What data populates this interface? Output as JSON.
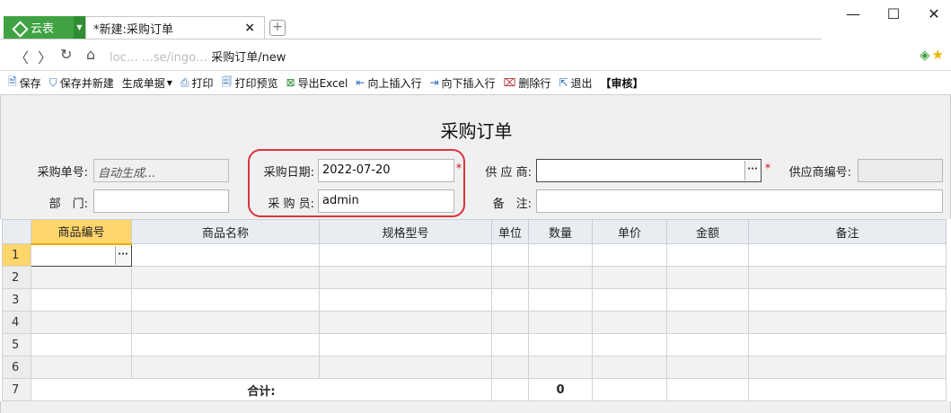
{
  "tabs": {
    "app_label": "云表",
    "doc_label": "*新建:采购订单",
    "close_glyph": "×",
    "new_tab_glyph": "+"
  },
  "window": {
    "minimize": "—",
    "maximize": "☐",
    "close": "✕"
  },
  "address": {
    "muted_part": "loc… …se/ingo… ",
    "path_part": "采购订单/new"
  },
  "toolbar": {
    "save": "保存",
    "save_new": "保存并新建",
    "generate": "生成单据",
    "print": "打印",
    "print_preview": "打印预览",
    "export_excel": "导出Excel",
    "insert_above": "向上插入行",
    "insert_below": "向下插入行",
    "delete_row": "删除行",
    "exit": "退出",
    "audit": "【审核】"
  },
  "form": {
    "title": "采购订单",
    "order_no_label": "采购单号:",
    "order_no_value": "自动生成...",
    "date_label": "采购日期:",
    "date_value": "2022-07-20",
    "supplier_label": "供 应 商:",
    "supplier_value": "",
    "supplier_code_label": "供应商编号:",
    "supplier_code_value": "",
    "dept_label": "部　门:",
    "dept_value": "",
    "buyer_label": "采 购 员:",
    "buyer_value": "admin",
    "remark_label": "备　注:",
    "remark_value": "",
    "required_mark": "*"
  },
  "grid": {
    "columns": [
      "商品编号",
      "商品名称",
      "规格型号",
      "单位",
      "数量",
      "单价",
      "金额",
      "备注"
    ],
    "rows": [
      "1",
      "2",
      "3",
      "4",
      "5",
      "6"
    ],
    "total_row_num": "7",
    "total_label": "合计:",
    "total_qty": "0"
  },
  "colors": {
    "brand_green": "#3fa343",
    "highlight_red": "#d8353f",
    "active_cell": "#ffd56c"
  }
}
